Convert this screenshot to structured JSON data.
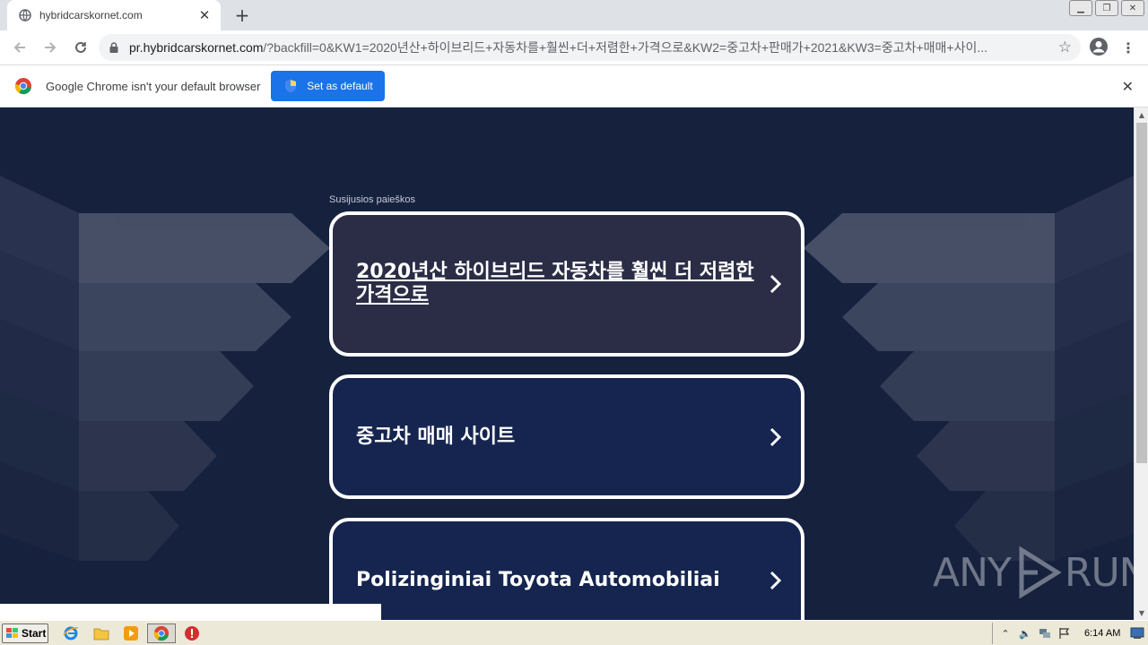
{
  "browser": {
    "tab_title": "hybridcarskornet.com",
    "new_tab_symbol": "+",
    "url_host": "pr.hybridcarskornet.com",
    "url_path": "/?backfill=0&KW1=2020년산+하이브리드+자동차를+훨씬+더+저렴한+가격으로&KW2=중고차+판매가+2021&KW3=중고차+매매+사이..."
  },
  "infobar": {
    "message": "Google Chrome isn't your default browser",
    "button_label": "Set as default"
  },
  "page": {
    "heading": "Susijusios paieškos",
    "links": [
      {
        "label": "2020년산 하이브리드 자동차를 훨씬 더 저렴한 가격으로"
      },
      {
        "label": "중고차 매매 사이트"
      },
      {
        "label": "Polizinginiai Toyota Automobiliai"
      }
    ],
    "watermark_left": "ANY",
    "watermark_right": "RUN"
  },
  "taskbar": {
    "start_label": "Start",
    "clock": "6:14 AM"
  },
  "colors": {
    "page_bg": "#15213d",
    "card1_bg": "#2a2d45",
    "card_bg": "#152550",
    "accent_button": "#1a73e8"
  }
}
